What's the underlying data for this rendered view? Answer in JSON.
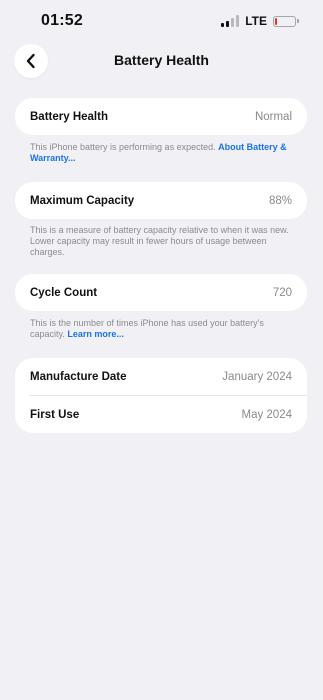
{
  "status_bar": {
    "time": "01:52",
    "network": "LTE",
    "battery_level": 0.12,
    "battery_color": "#e5342b"
  },
  "nav": {
    "back_icon": "chevron-left-icon",
    "title": "Battery Health"
  },
  "battery_health": {
    "label": "Battery Health",
    "value": "Normal",
    "description": "This iPhone battery is performing as expected.",
    "link": "About Battery & Warranty..."
  },
  "maximum_capacity": {
    "label": "Maximum Capacity",
    "value": "88%",
    "description": "This is a measure of battery capacity relative to when it was new. Lower capacity may result in fewer hours of usage between charges."
  },
  "cycle_count": {
    "label": "Cycle Count",
    "value": "720",
    "description": "This is the number of times iPhone has used your battery's capacity.",
    "link": "Learn more..."
  },
  "dates": {
    "manufacture_label": "Manufacture Date",
    "manufacture_value": "January 2024",
    "first_use_label": "First Use",
    "first_use_value": "May 2024"
  },
  "colors": {
    "background": "#f1f1f5",
    "link": "#1a73e8"
  }
}
